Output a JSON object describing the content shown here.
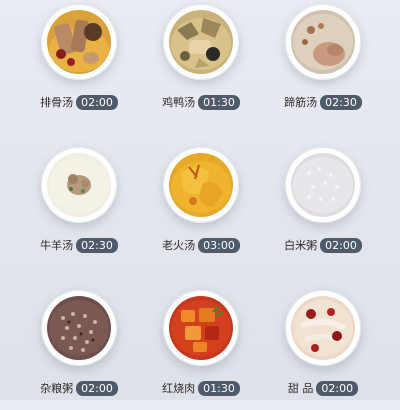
{
  "menu": {
    "items": [
      {
        "name": "排骨汤",
        "time": "02:00",
        "icon": "pork-rib-soup-icon"
      },
      {
        "name": "鸡鸭汤",
        "time": "01:30",
        "icon": "chicken-duck-soup-icon"
      },
      {
        "name": "蹄筋汤",
        "time": "02:30",
        "icon": "tendon-soup-icon"
      },
      {
        "name": "牛羊汤",
        "time": "02:30",
        "icon": "beef-lamb-soup-icon"
      },
      {
        "name": "老火汤",
        "time": "03:00",
        "icon": "slow-cooked-soup-icon"
      },
      {
        "name": "白米粥",
        "time": "02:00",
        "icon": "white-rice-porridge-icon"
      },
      {
        "name": "杂粮粥",
        "time": "02:00",
        "icon": "multigrain-porridge-icon"
      },
      {
        "name": "红烧肉",
        "time": "01:30",
        "icon": "braised-pork-icon"
      },
      {
        "name": "甜 品",
        "time": "02:00",
        "icon": "dessert-icon"
      }
    ]
  },
  "colors": {
    "time_badge": "#4f5a6a",
    "background": "#e4e8ee"
  }
}
